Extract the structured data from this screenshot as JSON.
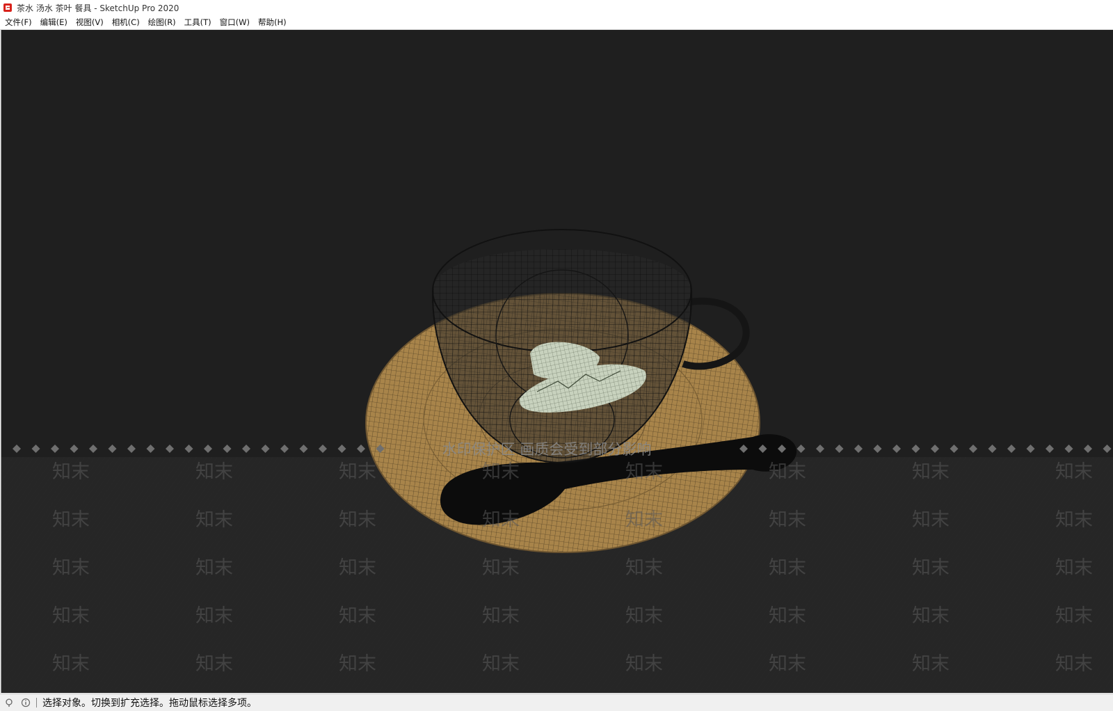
{
  "window": {
    "title": "茶水 汤水 茶叶 餐具 - SketchUp Pro 2020"
  },
  "menubar": {
    "items": [
      {
        "label": "文件(F)"
      },
      {
        "label": "编辑(E)"
      },
      {
        "label": "视图(V)"
      },
      {
        "label": "相机(C)"
      },
      {
        "label": "绘图(R)"
      },
      {
        "label": "工具(T)"
      },
      {
        "label": "窗口(W)"
      },
      {
        "label": "帮助(H)"
      }
    ]
  },
  "viewport": {
    "background_color": "#1f1f1f",
    "watermark_banner": "水印保护区   画质会受到部分影响",
    "watermark_text": "知末",
    "saucer_color": "#a8844a",
    "leaf_color": "#c8d2be"
  },
  "statusbar": {
    "icons": [
      "geo-location-icon",
      "info-icon"
    ],
    "message": "选择对象。切换到扩充选择。拖动鼠标选择多项。"
  }
}
